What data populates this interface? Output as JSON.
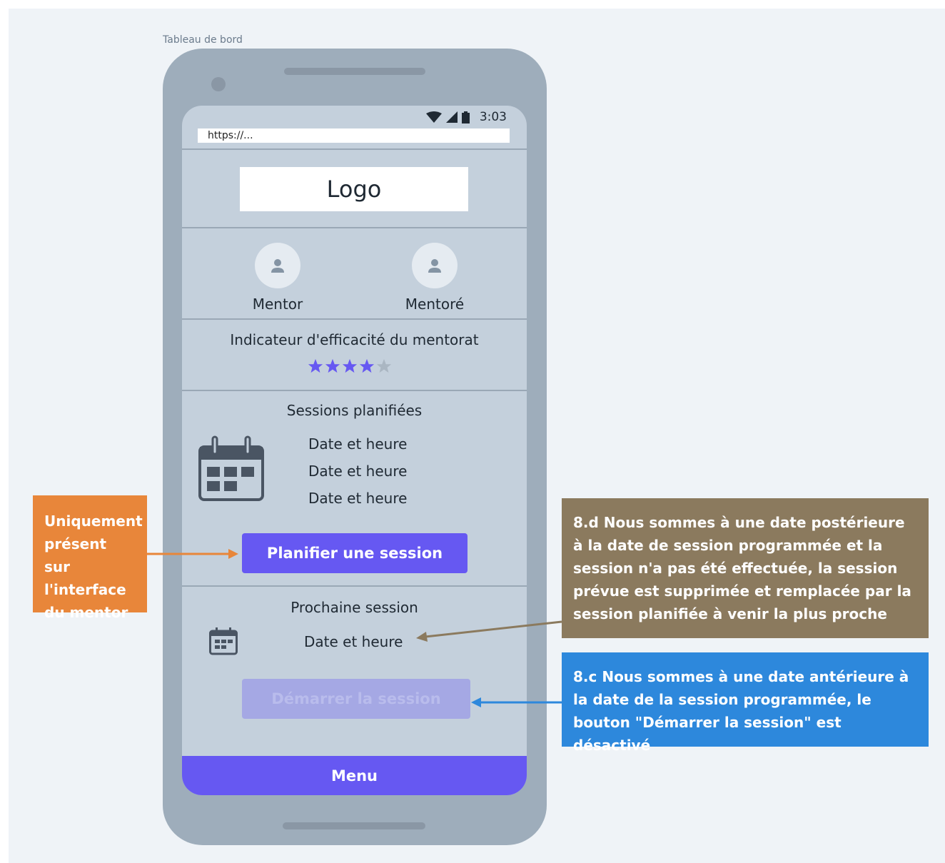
{
  "frame": {
    "label": "Tableau de bord"
  },
  "status_bar": {
    "time": "3:03"
  },
  "browser": {
    "url": "https://..."
  },
  "header": {
    "logo_text": "Logo"
  },
  "participants": {
    "mentor_label": "Mentor",
    "mentee_label": "Mentoré"
  },
  "effectiveness": {
    "title": "Indicateur d'efficacité du mentorat",
    "rating": 4,
    "max_rating": 5,
    "star_color": "#6658f2"
  },
  "planned_sessions": {
    "title": "Sessions planifiées",
    "items": [
      "Date et heure",
      "Date et heure",
      "Date et heure"
    ],
    "plan_button_label": "Planifier une session"
  },
  "next_session": {
    "title": "Prochaine session",
    "datetime": "Date et heure",
    "start_button_label": "Démarrer la session",
    "start_button_enabled": false
  },
  "bottom_nav": {
    "menu_label": "Menu"
  },
  "annotations": {
    "mentor_only": "Uniquement présent sur l'interface du mentor",
    "note_8d": "8.d Nous sommes à une date postérieure à la date de session programmée et la session n'a pas été effectuée, la session prévue est supprimée et remplacée par la session planifiée à venir la plus proche",
    "note_8c": "8.c Nous sommes à une date antérieure à la date de la session programmée, le bouton \"Démarrer la session\" est désactivé"
  },
  "colors": {
    "accent": "#6658f2",
    "orange_note": "#e8863a",
    "brown_note": "#8b7a5e",
    "blue_note": "#2d88dc",
    "disabled_button": "#a5a8e4"
  }
}
